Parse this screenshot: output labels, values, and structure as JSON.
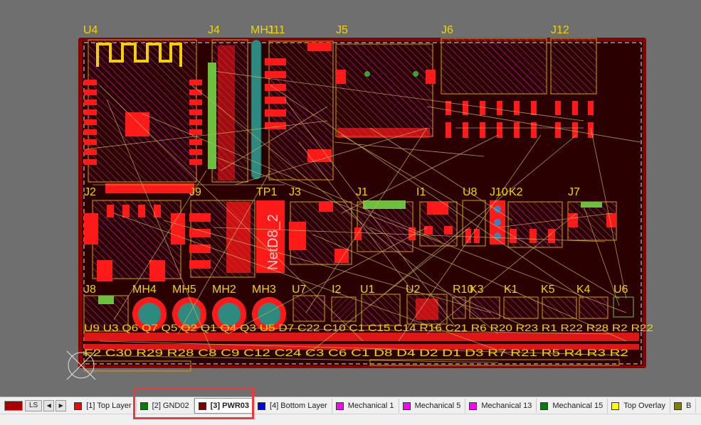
{
  "layer_bar": {
    "current_layer_label": "LS",
    "nav": {
      "prev": "◀",
      "next": "▶"
    },
    "tabs": [
      {
        "label": "[1] Top Layer",
        "color": "#ff0000"
      },
      {
        "label": "[2] GND02",
        "color": "#008000"
      },
      {
        "label": "[3] PWR03",
        "color": "#800000",
        "active": true
      },
      {
        "label": "[4] Bottom Layer",
        "color": "#0000ff"
      },
      {
        "label": "Mechanical 1",
        "color": "#ff00ff"
      },
      {
        "label": "Mechanical 5",
        "color": "#ff00ff"
      },
      {
        "label": "Mechanical 13",
        "color": "#ff00ff"
      },
      {
        "label": "Mechanical 15",
        "color": "#008000"
      },
      {
        "label": "Top Overlay",
        "color": "#ffff00"
      },
      {
        "label": "B",
        "color": "#808000"
      }
    ]
  },
  "designators": {
    "U4": "U4",
    "J4": "J4",
    "MH1": "MH1",
    "J11": "J11",
    "J5": "J5",
    "J6": "J6",
    "J12": "J12",
    "J2": "J2",
    "J9": "J9",
    "TP1": "TP1",
    "J3": "J3",
    "J1": "J1",
    "I1": "I1",
    "U8": "U8",
    "J10": "J10",
    "K2": "K2",
    "J7": "J7",
    "J8": "J8",
    "MH4": "MH4",
    "MH5": "MH5",
    "MH2": "MH2",
    "MH3": "MH3",
    "U7": "U7",
    "I2": "I2",
    "U1": "U1",
    "U2": "U2",
    "R10": "R10",
    "K3": "K3",
    "K1": "K1",
    "K5": "K5",
    "K4": "K4",
    "U6": "U6",
    "netd": "NetD8_2",
    "row1": "U9 U3 Q6 Q7 Q5 Q2 Q1 Q4 Q3 U5 D7 C22 C10 C1 C15 C14 R16 C21 R6 R20 R23 R1 R22 R28 R2 R22",
    "row2": "F2 C30 R29 R28 C8 C9 C12 C24 C3 C6 C1 D8 D4 D2 D1 D3 R7 R21 R5 R4 R3 R2"
  }
}
